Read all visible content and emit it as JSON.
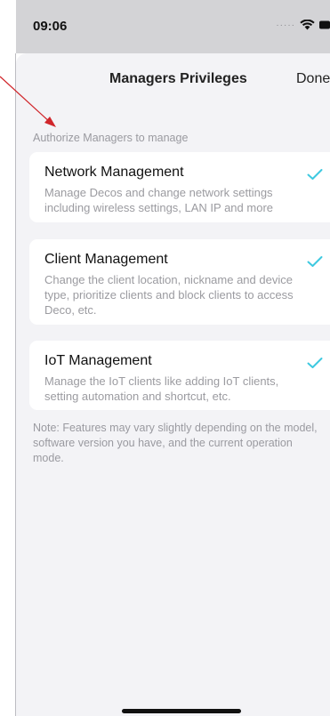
{
  "status": {
    "time": "09:06"
  },
  "nav": {
    "title": "Managers Privileges",
    "done_label": "Done"
  },
  "section_label": "Authorize Managers to manage",
  "cards": [
    {
      "title": "Network Management",
      "description": "Manage Decos and change network settings including wireless settings, LAN IP and more",
      "checked": true
    },
    {
      "title": "Client Management",
      "description": "Change the client location, nickname and device type, prioritize clients and block clients to access Deco, etc.",
      "checked": true
    },
    {
      "title": "IoT Management",
      "description": "Manage the IoT clients like adding IoT clients, setting automation and shortcut, etc.",
      "checked": true
    }
  ],
  "note": "Note: Features may vary slightly depending on the model, software version you have, and the current operation mode.",
  "colors": {
    "check": "#3ec9e0",
    "annotation_arrow": "#d0262b",
    "sheet_bg": "#f3f3f6"
  }
}
